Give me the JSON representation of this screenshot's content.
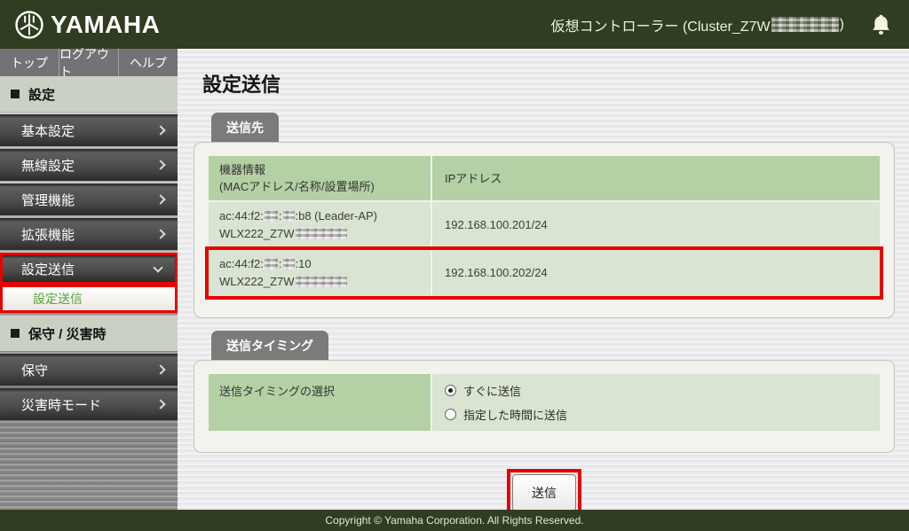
{
  "titlebar": {
    "brand": "YAMAHA",
    "controller_prefix": "仮想コントローラー (Cluster_Z7W",
    "controller_suffix": ")"
  },
  "nav_tabs": [
    {
      "label": "トップ"
    },
    {
      "label": "ログアウト"
    },
    {
      "label": "ヘルプ"
    }
  ],
  "sidebar": {
    "section_settings": "設定",
    "menu_items": [
      {
        "label": "基本設定"
      },
      {
        "label": "無線設定"
      },
      {
        "label": "管理機能"
      },
      {
        "label": "拡張機能"
      },
      {
        "label": "設定送信"
      }
    ],
    "submenu_item": "設定送信",
    "section_maintenance": "保守 / 災害時",
    "maintenance_items": [
      {
        "label": "保守"
      },
      {
        "label": "災害時モード"
      }
    ]
  },
  "main": {
    "title": "設定送信",
    "destination": {
      "section_label": "送信先",
      "col1_line1": "機器情報",
      "col1_line2": "(MACアドレス/名称/設置場所)",
      "col2": "IPアドレス",
      "rows": [
        {
          "mac_p1": "ac:44:f2:",
          "mac_sep": ":",
          "mac_p3": ":b8 (Leader-AP)",
          "name_prefix": "WLX222_Z7W",
          "ip": "192.168.100.201/24"
        },
        {
          "mac_p1": "ac:44:f2:",
          "mac_sep": ":",
          "mac_p3": ":10",
          "name_prefix": "WLX222_Z7W",
          "ip": "192.168.100.202/24"
        }
      ]
    },
    "timing": {
      "section_label": "送信タイミング",
      "row_label": "送信タイミングの選択",
      "options": [
        {
          "label": "すぐに送信",
          "selected": true
        },
        {
          "label": "指定した時間に送信",
          "selected": false
        }
      ],
      "selected_option": "すぐに送信"
    },
    "submit_label": "送信"
  },
  "footer": {
    "copyright": "Copyright © Yamaha Corporation. All Rights Reserved."
  },
  "icons": {
    "brand_mark": "tuning-fork-icon",
    "notification": "bell-icon",
    "menu_expandable": "chevron-right-icon",
    "menu_expanded": "chevron-down-icon"
  },
  "colors": {
    "topbar_green": "#2f3d20",
    "table_header_green": "#b4d0a5",
    "table_row_green": "#d9e4d2",
    "annotation_red": "#e60000",
    "active_link_green": "#55a33e"
  }
}
